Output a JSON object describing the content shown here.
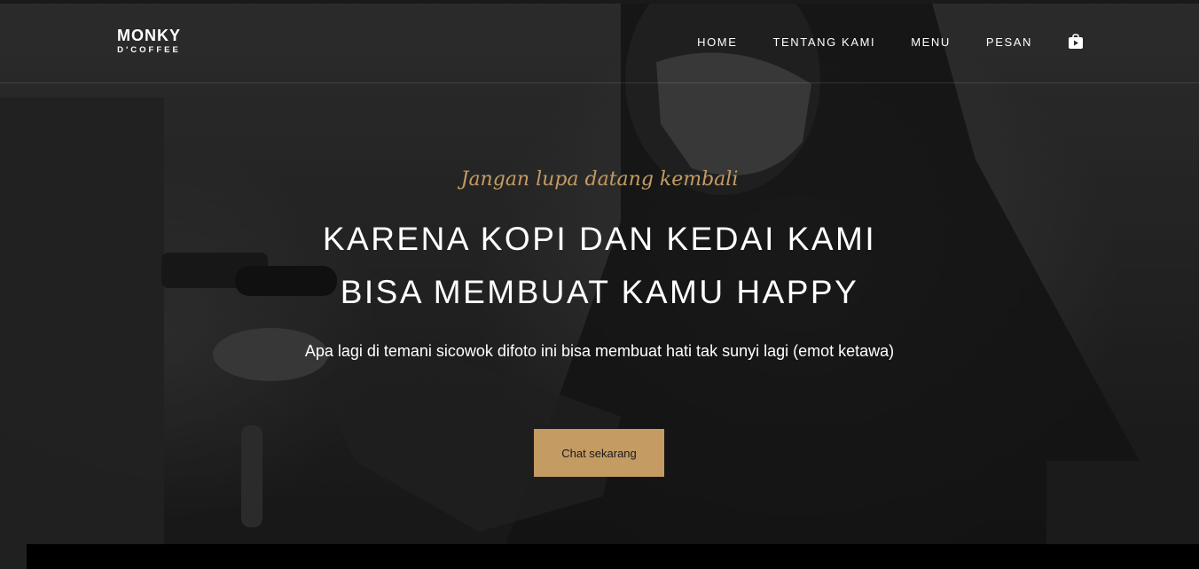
{
  "brand": {
    "name": "MONKY",
    "sub": "D'COFFEE"
  },
  "nav": {
    "items": [
      {
        "label": "HOME"
      },
      {
        "label": "TENTANG KAMI"
      },
      {
        "label": "MENU"
      },
      {
        "label": "PESAN"
      }
    ],
    "icon": "shopping-bag-play-icon"
  },
  "hero": {
    "tagline": "Jangan lupa datang kembali",
    "headline_line1": "KARENA KOPI DAN KEDAI KAMI",
    "headline_line2": "BISA MEMBUAT KAMU HAPPY",
    "subtext": "Apa lagi di temani sicowok difoto ini bisa membuat hati tak sunyi lagi (emot ketawa)",
    "cta_label": "Chat sekarang"
  },
  "colors": {
    "accent": "#c49b63",
    "background": "#2b2b2b",
    "text": "#ffffff"
  }
}
